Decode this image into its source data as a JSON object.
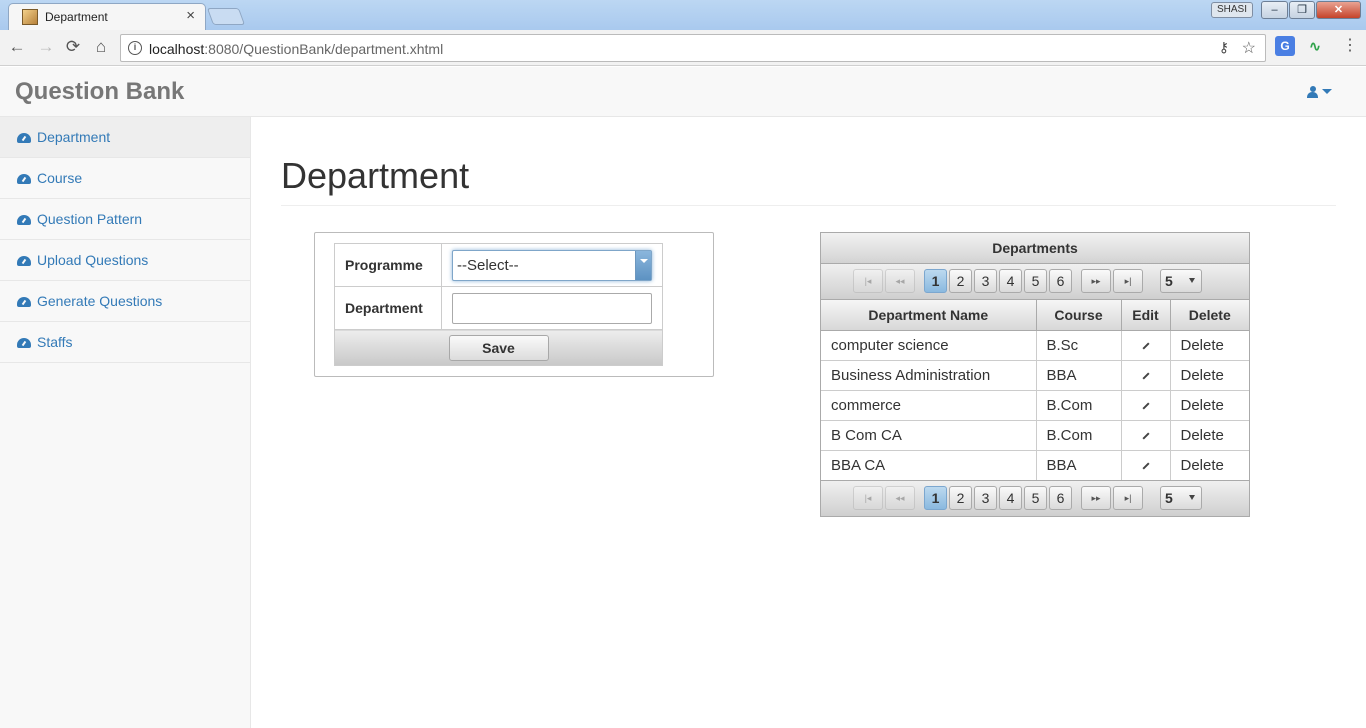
{
  "browser": {
    "tab_title": "Department",
    "tab_close": "×",
    "profile": "SHASI",
    "url_host": "localhost",
    "url_path": ":8080/QuestionBank/department.xhtml",
    "min": "–",
    "restore": "❐",
    "close": "✕",
    "back": "←",
    "forward": "→",
    "reload": "⟳",
    "home": "⌂",
    "key": "⚷",
    "star": "☆",
    "translate": "G",
    "wave": "∿",
    "menu": "⋮"
  },
  "app": {
    "brand": "Question Bank"
  },
  "sidebar": {
    "items": [
      {
        "label": "Department",
        "icon": "dashboard-icon"
      },
      {
        "label": "Course",
        "icon": "dashboard-icon"
      },
      {
        "label": "Question Pattern",
        "icon": "dashboard-icon"
      },
      {
        "label": "Upload Questions",
        "icon": "dashboard-icon"
      },
      {
        "label": "Generate Questions",
        "icon": "dashboard-icon"
      },
      {
        "label": "Staffs",
        "icon": "dashboard-icon"
      }
    ]
  },
  "page": {
    "title": "Department"
  },
  "form": {
    "programme_label": "Programme",
    "programme_value": "--Select--",
    "department_label": "Department",
    "department_value": "",
    "save_label": "Save"
  },
  "departments": {
    "header": "Departments",
    "pages": [
      "1",
      "2",
      "3",
      "4",
      "5",
      "6"
    ],
    "current_page": "1",
    "rows_per_page": "5",
    "nav": {
      "first": "|◂",
      "prev": "◂◂",
      "next": "▸▸",
      "last": "▸|"
    },
    "columns": [
      "Department Name",
      "Course",
      "Edit",
      "Delete"
    ],
    "rows": [
      {
        "name": "computer science",
        "course": "B.Sc",
        "delete": "Delete"
      },
      {
        "name": "Business Administration",
        "course": "BBA",
        "delete": "Delete"
      },
      {
        "name": "commerce",
        "course": "B.Com",
        "delete": "Delete"
      },
      {
        "name": "B Com CA",
        "course": "B.Com",
        "delete": "Delete"
      },
      {
        "name": "BBA CA",
        "course": "BBA",
        "delete": "Delete"
      }
    ]
  }
}
